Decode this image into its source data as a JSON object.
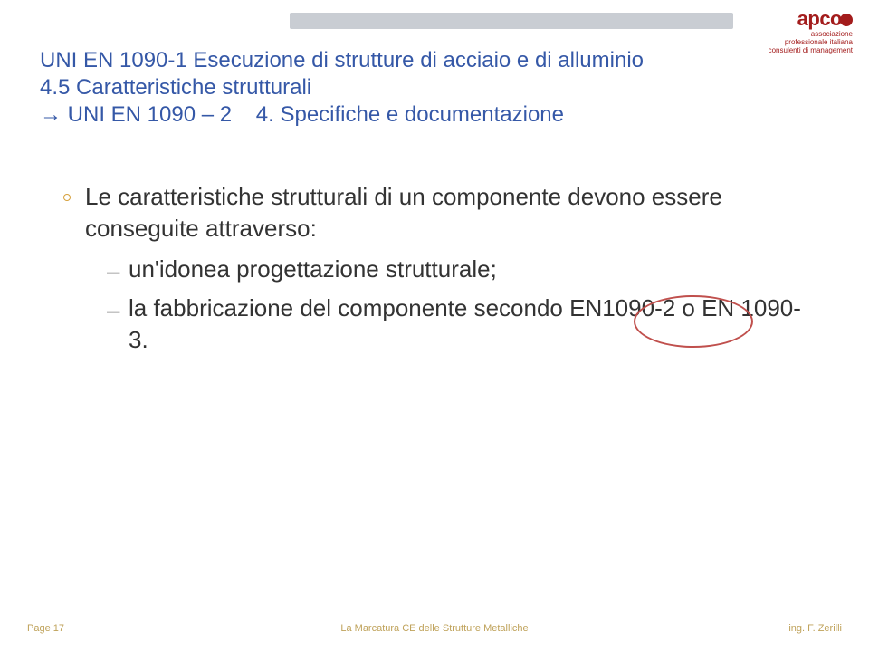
{
  "logo": {
    "name": "apco",
    "line1": "associazione",
    "line2": "professionale italiana",
    "line3": "consulenti di management"
  },
  "title": {
    "line1": "UNI EN 1090-1 Esecuzione di strutture di acciaio e di alluminio",
    "line2": "4.5 Caratteristiche strutturali",
    "line3_prefix": "→ UNI EN 1090 – 2",
    "line3_suffix": "4. Specifiche e documentazione"
  },
  "bullet_main": "Le caratteristiche strutturali di un componente devono essere conseguite attraverso:",
  "sub1": "un'idonea progettazione strutturale;",
  "sub2": "la fabbricazione del componente secondo EN1090-2 o EN 1090-3.",
  "footer": {
    "left": "Page 17",
    "center": "La Marcatura CE delle Strutture Metalliche",
    "right": "ing. F. Zerilli"
  }
}
